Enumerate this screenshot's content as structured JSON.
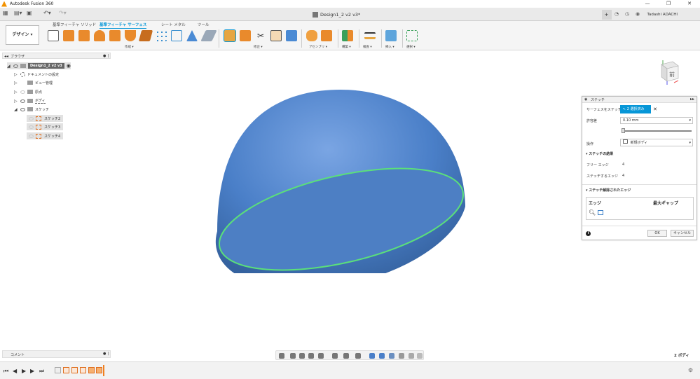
{
  "window": {
    "title": "Autodesk Fusion 360",
    "controls": [
      "minimize-icon",
      "restore-icon",
      "close-icon"
    ]
  },
  "tabbar": {
    "doc_title": "Design1_2 v2 v3*",
    "user": "Tadashi ADACHI"
  },
  "ribbon": {
    "workspace": "デザイン ▾",
    "tabs": [
      "基準フィーチャ ソリッド",
      "基準フィーチャ サーフェス",
      "シート メタル",
      "ツール"
    ],
    "active_tab": "基準フィーチャ サーフェス",
    "groups": [
      "作成 ▾",
      "修正 ▾",
      "アセンブリ ▾",
      "構築 ▾",
      "検査 ▾",
      "挿入 ▾",
      "選択 ▾"
    ]
  },
  "browser": {
    "title": "ブラウザ",
    "items": [
      {
        "label": "Design1_2 v2 v3"
      },
      {
        "label": "ドキュメントの設定"
      },
      {
        "label": "ビュー管理"
      },
      {
        "label": "原点"
      },
      {
        "label": "ボディ"
      },
      {
        "label": "スケッチ"
      },
      {
        "label": "スケッチ2"
      },
      {
        "label": "スケッチ3"
      },
      {
        "label": "スケッチ4"
      }
    ]
  },
  "viewcube": {
    "face_label": "前"
  },
  "panel": {
    "title": "ステッチ",
    "surfaces_label": "サーフェスをステッチ",
    "surfaces_value": "2 選択済み",
    "tolerance_label": "許容差",
    "tolerance_value": "0.10 mm",
    "operation_label": "操作",
    "operation_value": "新規ボディ",
    "results_section": "ステッチの結果",
    "free_edges_label": "フリー エッジ",
    "free_edges_value": "4",
    "stitched_edges_label": "ステッチするエッジ",
    "stitched_edges_value": "4",
    "stitched_section": "ステッチ解除されたエッジ",
    "edge_col": "エッジ",
    "gap_col": "最大ギャップ",
    "ok": "OK",
    "cancel": "キャンセル"
  },
  "bottom": {
    "comment_label": "コメント",
    "body_count": "2 ボディ"
  },
  "colors": {
    "accent": "#0696d7",
    "dome": "#4a7fc8",
    "edge": "#5be07a"
  }
}
